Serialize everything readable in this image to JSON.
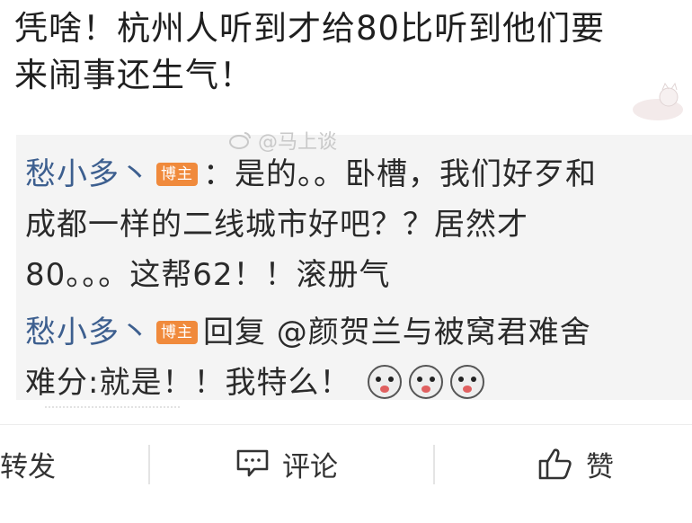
{
  "post": {
    "text_line1": "凭啥！杭州人听到才给80比听到他们要",
    "text_line2": "来闹事还生气！"
  },
  "watermark": {
    "text": "@马上谈"
  },
  "comments": [
    {
      "user": "愁小多丶",
      "badge": "博主",
      "text1": "：是的。。卧槽，我们好歹和",
      "text2": "成都一样的二线城市好吧？？居然才",
      "text3": "80。。。这帮62！！滚册气"
    },
    {
      "user": "愁小多丶",
      "badge": "博主",
      "text1": "回复 @颜贺兰与被窝君难舍",
      "text2": "难分:就是！！我特么！"
    }
  ],
  "actions": {
    "repost": "转发",
    "comment": "评论",
    "like": "赞"
  },
  "colors": {
    "username": "#3d5f8f",
    "badge": "#f08a3c",
    "comment_bg": "#f4f4f4"
  }
}
